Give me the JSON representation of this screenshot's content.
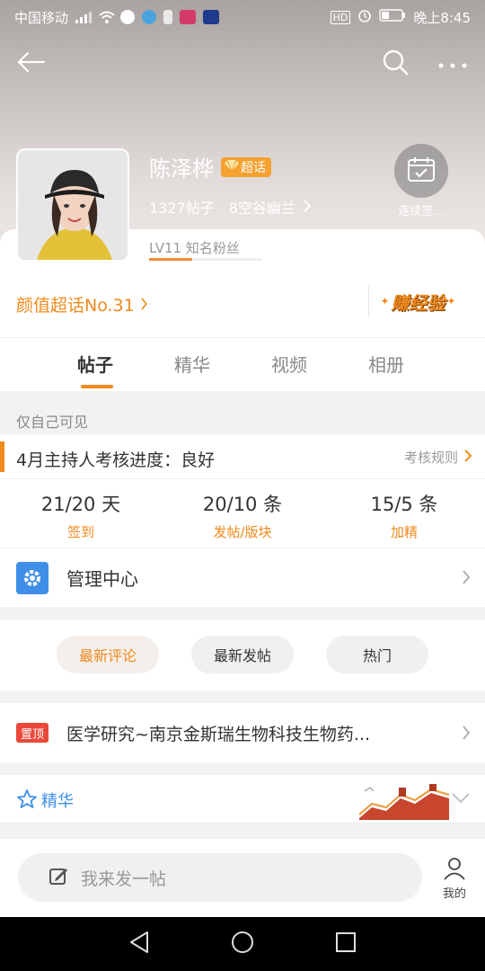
{
  "status_bar": {
    "carrier": "中国移动",
    "time": "晚上8:45",
    "hd": "HD"
  },
  "profile": {
    "name": "陈泽桦",
    "badge": "超话",
    "posts": "1327帖子",
    "community": "8空谷幽兰",
    "level": "LV11 知名粉丝",
    "level_progress": 0.38,
    "checkin_label": "连续签..."
  },
  "rank": {
    "label": "颜值超话No.31"
  },
  "earn": {
    "label": "赚经验"
  },
  "tabs": [
    {
      "label": "帖子",
      "active": true
    },
    {
      "label": "精华",
      "active": false
    },
    {
      "label": "视频",
      "active": false
    },
    {
      "label": "相册",
      "active": false
    }
  ],
  "visibility": "仅自己可见",
  "assessment": {
    "title": "4月主持人考核进度：良好",
    "rule": "考核规则",
    "stats": [
      {
        "value": "21/20 天",
        "label": "签到"
      },
      {
        "value": "20/10 条",
        "label": "发帖/版块"
      },
      {
        "value": "15/5 条",
        "label": "加精"
      }
    ]
  },
  "manage": {
    "label": "管理中心"
  },
  "filters": [
    {
      "label": "最新评论",
      "active": true
    },
    {
      "label": "最新发帖",
      "active": false
    },
    {
      "label": "热门",
      "active": false
    }
  ],
  "pinned": {
    "tag": "置顶",
    "text": "医学研究~南京金斯瑞生物科技生物药..."
  },
  "essence": {
    "label": "精华"
  },
  "composer": {
    "placeholder": "我来发一帖",
    "mine_label": "我的"
  },
  "colors": {
    "accent": "#f08a1c",
    "blue": "#3f8fe8",
    "pin_red": "#e8493a"
  }
}
